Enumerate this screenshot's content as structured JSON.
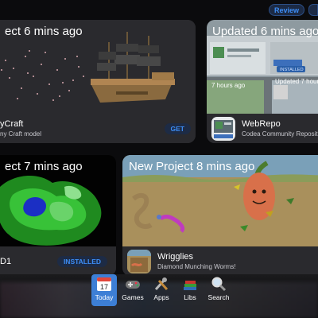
{
  "header": {
    "review_label": "Review"
  },
  "cards": {
    "voxel": {
      "thumb_title": "ect 6 mins ago",
      "name": "yCraft",
      "subtitle": "ny Craft model",
      "button": "GET"
    },
    "webrepo": {
      "thumb_title": "Updated 6 mins ago",
      "inner_label_1": "7 hours ago",
      "inner_label_2": "Updated 7 hours",
      "inner_badge": "INSTALLED",
      "name": "WebRepo",
      "subtitle": "Codea Community Repositor"
    },
    "d1": {
      "thumb_title": "ect 7 mins ago",
      "name": "D1",
      "button": "INSTALLED"
    },
    "wrigglies": {
      "thumb_title": "New Project 8 mins ago",
      "name": "Wrigglies",
      "subtitle": "Diamond Munching Worms!"
    }
  },
  "tabbar": {
    "tabs": [
      {
        "label": "Today",
        "icon": "calendar-icon",
        "active": true
      },
      {
        "label": "Games",
        "icon": "gamepad-icon",
        "active": false
      },
      {
        "label": "Apps",
        "icon": "tools-icon",
        "active": false
      },
      {
        "label": "Libs",
        "icon": "books-icon",
        "active": false
      },
      {
        "label": "Search",
        "icon": "magnifier-icon",
        "active": false
      }
    ],
    "today_date": "17"
  },
  "colors": {
    "accent": "#3d8df5",
    "active_tab": "#3d7fd6",
    "card_bg": "#2a2a2e"
  }
}
